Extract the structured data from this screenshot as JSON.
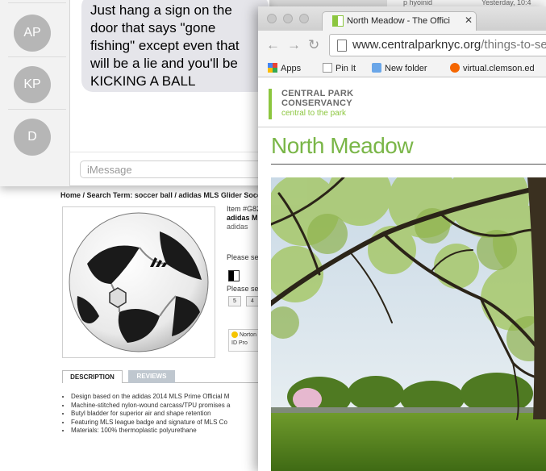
{
  "shop": {
    "breadcrumb": "Home / Search Term: soccer ball / adidas MLS Glider Socc",
    "item_number": "Item #G82",
    "product_name": "adidas M",
    "brand": "adidas",
    "select_color_prompt": "Please sel",
    "select_size_prompt": "Please sel",
    "sizes": [
      "5",
      "4"
    ],
    "norton_label": "Norton",
    "id_protect_label": "ID Pro",
    "tabs": {
      "description": "DESCRIPTION",
      "reviews": "REVIEWS"
    },
    "bullets": [
      "Design based on the adidas 2014 MLS Prime Official M",
      "Machine-stitched nylon-wound carcass/TPU promises a",
      "Butyl bladder for superior air and shape retention",
      "Featuring MLS league badge and signature of MLS Co",
      "Materials: 100% thermoplastic polyurethane"
    ]
  },
  "messages": {
    "contacts": [
      {
        "initials": "AP"
      },
      {
        "initials": "KP"
      },
      {
        "initials": "D"
      }
    ],
    "bubble_lines": [
      "Just hang a sign on the",
      "door that says \"gone",
      "fishing\" except even that",
      "will be a lie and you'll be",
      "KICKING A BALL"
    ],
    "composer_placeholder": "iMessage"
  },
  "peek": {
    "text1": "p hyoinid",
    "text2": "Yesterday, 10:4"
  },
  "chrome": {
    "tab_title": "North Meadow - The Offici",
    "url_host": "www.centralparknyc.org",
    "url_path": "/things-to-see",
    "bookmarks": [
      "Apps",
      "Pin It",
      "New folder",
      "virtual.clemson.ed"
    ],
    "logo_line1": "CENTRAL PARK",
    "logo_line2": "CONSERVANCY",
    "logo_tagline": "central to the park",
    "page_title": "North Meadow"
  },
  "colors": {
    "park_green": "#7ab648",
    "bubble_gray": "#e5e5ea",
    "avatar_gray": "#b6b6b6"
  }
}
